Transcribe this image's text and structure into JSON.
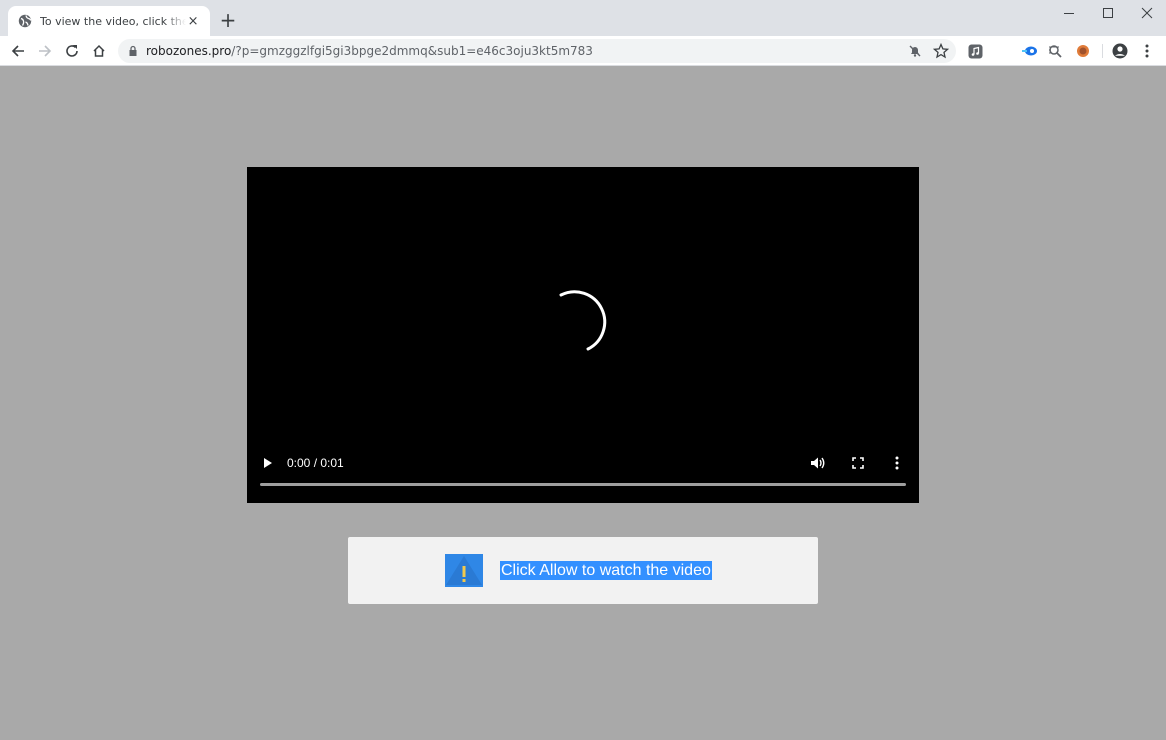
{
  "browser": {
    "tab": {
      "title": "To view the video, click the Allow",
      "close_glyph": "×",
      "favicon": "globe-icon"
    },
    "new_tab_glyph": "+",
    "window_controls": [
      "minimize-icon",
      "maximize-icon",
      "close-icon"
    ],
    "nav_icons": [
      "back-icon",
      "forward-icon",
      "reload-icon",
      "home-icon"
    ],
    "url": {
      "host": "robozones.pro",
      "path": "/?p=gmzggzlfgi5gi3bpge2dmmq&sub1=e46c3oju3kt5m783"
    },
    "omnibox_icons": [
      "lock-icon",
      "notifications-blocked-icon",
      "bookmark-star-icon"
    ],
    "extension_icons": [
      "music-extension-icon",
      "extension-icon",
      "extension-icon",
      "extension-icon",
      "profile-icon",
      "menu-icon"
    ]
  },
  "video": {
    "time": "0:00 / 0:01",
    "progress": 0,
    "controls": [
      "play-icon",
      "volume-icon",
      "fullscreen-icon",
      "more-options-icon"
    ]
  },
  "notice": {
    "message": "Click Allow to watch the video",
    "icon": "warning-icon",
    "accent": "#3390ff"
  }
}
